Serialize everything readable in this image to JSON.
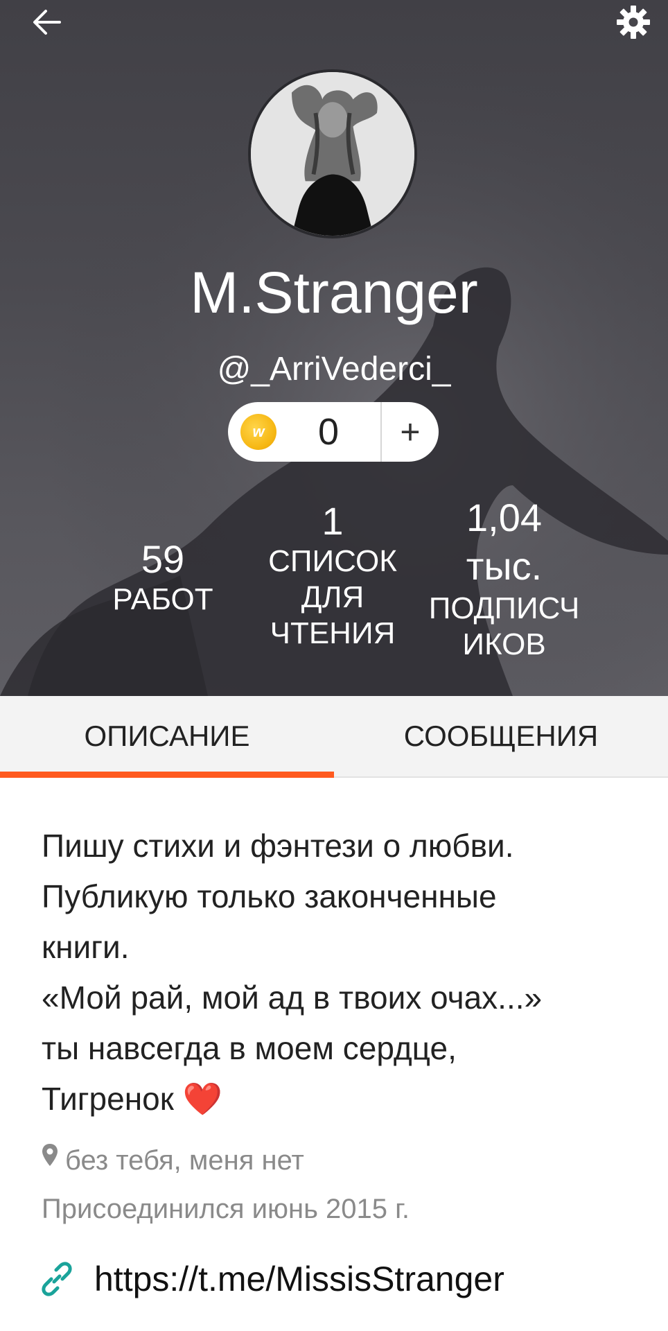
{
  "header": {
    "display_name": "M.Stranger",
    "username": "@_ArriVederci_",
    "coins": {
      "coin_symbol": "w",
      "count": "0",
      "add_label": "+"
    },
    "stats": {
      "works": {
        "value": "59",
        "label": "РАБОТ"
      },
      "reading_lists": {
        "value": "1",
        "label_line1": "СПИСОК",
        "label_line2": "ДЛЯ",
        "label_line3": "ЧТЕНИЯ"
      },
      "followers": {
        "value_line1": "1,04",
        "value_line2": "тыс.",
        "label_line1": "ПОДПИСЧ",
        "label_line2": "ИКОВ"
      }
    },
    "icons": {
      "back": "arrow-left-icon",
      "settings": "gear-icon"
    }
  },
  "tabs": [
    {
      "label": "ОПИСАНИЕ",
      "active": true
    },
    {
      "label": "СООБЩЕНИЯ",
      "active": false
    }
  ],
  "about": {
    "bio": "Пишу стихи и фэнтези о любви.\nПубликую только законченные\nкниги.\n«Мой рай, мой ад в твоих очах...»\nты навсегда в моем сердце,\nТигренок ❤️",
    "location": "без тебя, меня нет",
    "joined": "Присоединился июнь 2015 г.",
    "link": "https://t.me/MissisStranger"
  },
  "colors": {
    "accent": "#ff5a1f",
    "link_icon": "#1aa39a",
    "muted_text": "#8a8a8a"
  }
}
